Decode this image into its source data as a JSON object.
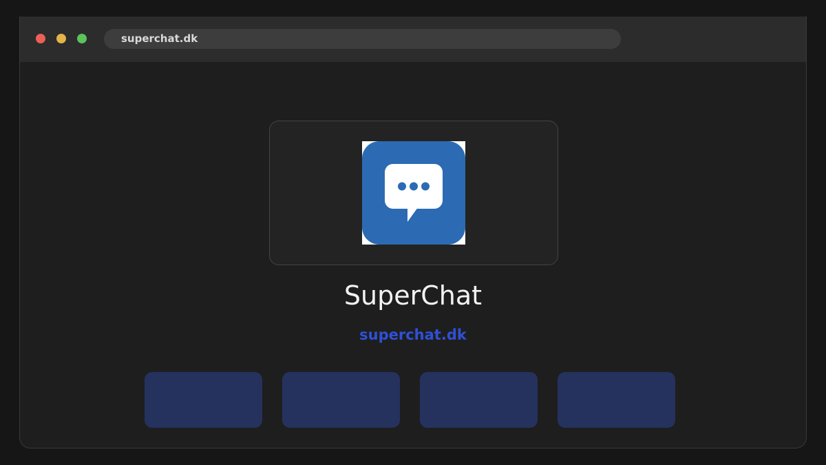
{
  "browser": {
    "url": "superchat.dk"
  },
  "app": {
    "name": "SuperChat",
    "link": "superchat.dk",
    "icon": "chat-bubble-icon",
    "icon_color": "#2c6bb3"
  },
  "tiles": [
    {
      "name": "tile-1"
    },
    {
      "name": "tile-2"
    },
    {
      "name": "tile-3"
    },
    {
      "name": "tile-4"
    }
  ],
  "colors": {
    "link": "#2f50d6",
    "tile": "#25325e"
  }
}
